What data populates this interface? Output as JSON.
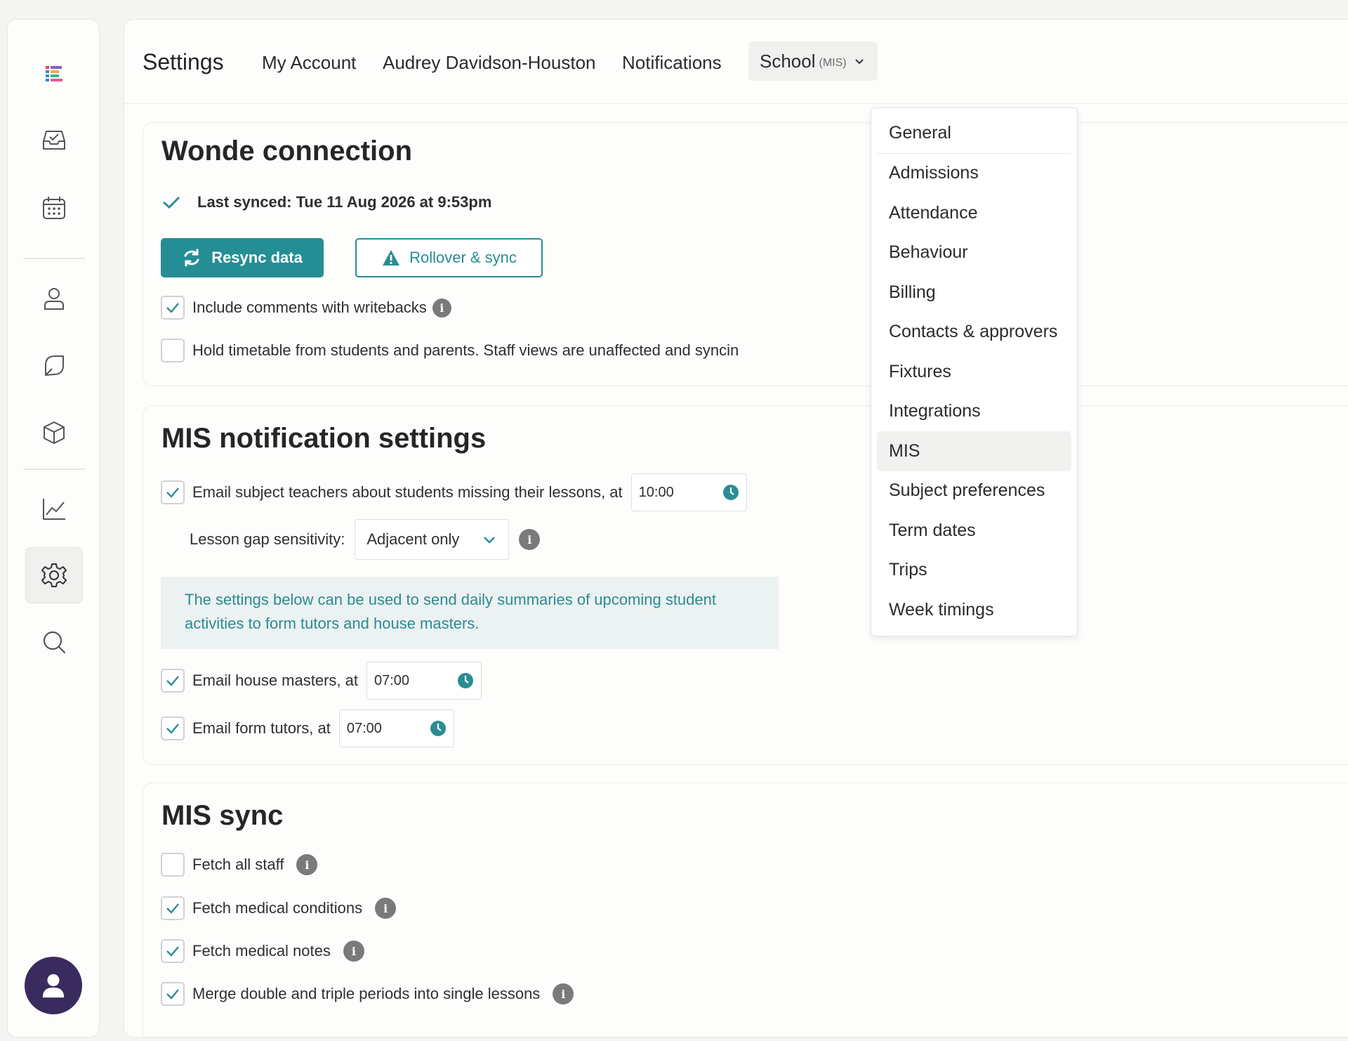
{
  "rail": {
    "items": [
      {
        "name": "logo-icon"
      },
      {
        "name": "inbox-icon"
      },
      {
        "name": "calendar-icon"
      },
      {
        "name": "person-icon"
      },
      {
        "name": "leaf-icon"
      },
      {
        "name": "cube-icon"
      },
      {
        "name": "chart-icon"
      },
      {
        "name": "gear-icon",
        "active": true
      },
      {
        "name": "search-icon"
      }
    ],
    "avatar": "user-avatar-icon",
    "colors": {
      "avatar_bg": "#3a2b5f",
      "accent": "#258e95"
    }
  },
  "header": {
    "title": "Settings",
    "tabs": [
      "My Account",
      "Audrey Davidson-Houston",
      "Notifications"
    ],
    "school_tab": {
      "label": "School",
      "suffix": "(MIS)"
    }
  },
  "dropdown": {
    "items": [
      "General",
      "Admissions",
      "Attendance",
      "Behaviour",
      "Billing",
      "Contacts & approvers",
      "Fixtures",
      "Integrations",
      "MIS",
      "Subject preferences",
      "Term dates",
      "Trips",
      "Week timings"
    ],
    "selected": "MIS"
  },
  "wonde": {
    "title": "Wonde connection",
    "last_synced": "Last synced: Tue 11 Aug 2026 at 9:53pm",
    "resync_label": "Resync data",
    "rollover_label": "Rollover & sync",
    "include_comments": {
      "label": "Include comments with writebacks",
      "checked": true
    },
    "hold_timetable": {
      "label": "Hold timetable from students and parents. Staff views are unaffected and syncin",
      "checked": false
    }
  },
  "mis_notifications": {
    "title": "MIS notification settings",
    "email_subject": {
      "label": "Email subject teachers about students missing their lessons, at",
      "time": "10:00",
      "checked": true
    },
    "lesson_gap": {
      "label": "Lesson gap sensitivity:",
      "value": "Adjacent only"
    },
    "notice": "The settings below can be used to send daily summaries of upcoming student activities to form tutors and house masters.",
    "email_house": {
      "label": "Email house masters, at",
      "time": "07:00",
      "checked": true
    },
    "email_form": {
      "label": "Email form tutors, at",
      "time": "07:00",
      "checked": true
    }
  },
  "mis_sync": {
    "title": "MIS sync",
    "fetch_staff": {
      "label": "Fetch all staff",
      "checked": false
    },
    "fetch_conditions": {
      "label": "Fetch medical conditions",
      "checked": true
    },
    "fetch_notes": {
      "label": "Fetch medical notes",
      "checked": true
    },
    "merge_periods": {
      "label": "Merge double and triple periods into single lessons",
      "checked": true
    }
  }
}
